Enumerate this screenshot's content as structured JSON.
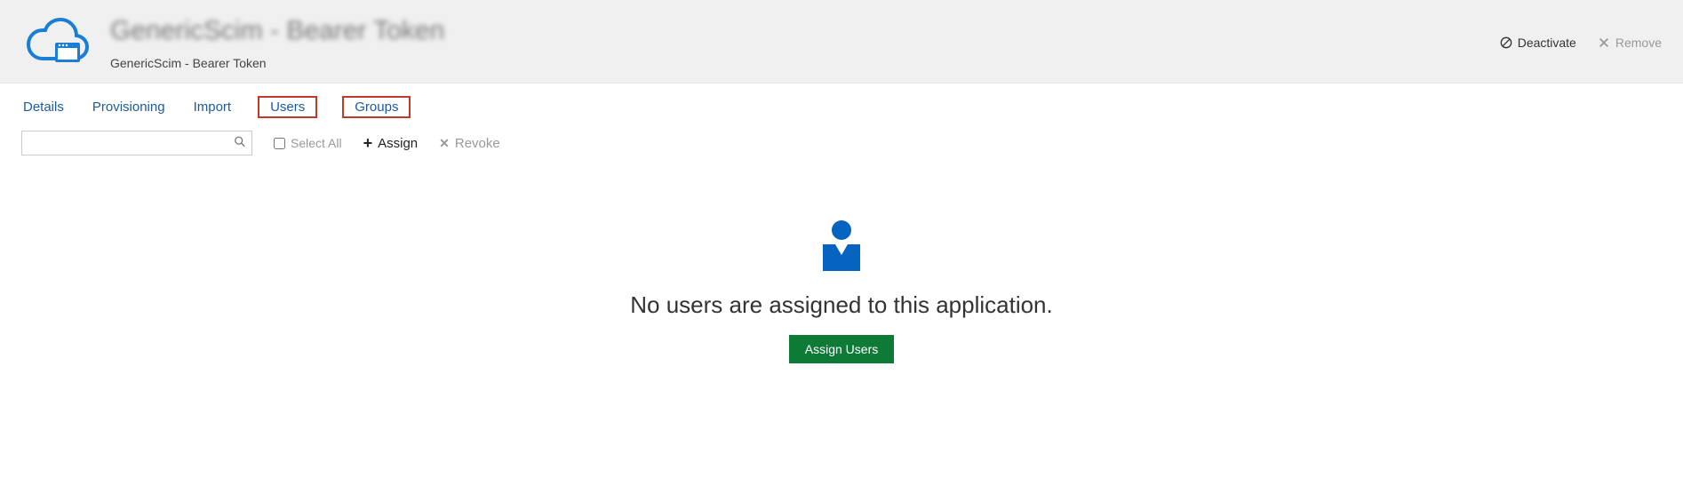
{
  "header": {
    "title_blurred": "GenericScim - Bearer Token",
    "subtitle": "GenericScim - Bearer Token",
    "deactivate_label": "Deactivate",
    "remove_label": "Remove"
  },
  "tabs": {
    "details": "Details",
    "provisioning": "Provisioning",
    "import": "Import",
    "users": "Users",
    "groups": "Groups"
  },
  "toolbar": {
    "search_value": "",
    "select_all_label": "Select All",
    "assign_label": "Assign",
    "revoke_label": "Revoke"
  },
  "empty": {
    "message": "No users are assigned to this application.",
    "button_label": "Assign Users"
  }
}
